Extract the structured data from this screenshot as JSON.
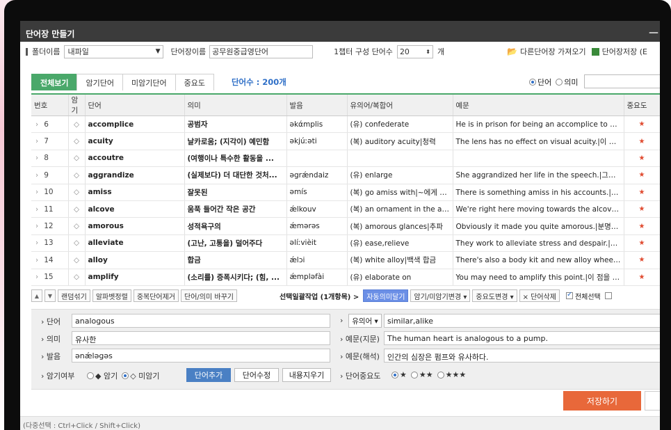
{
  "window": {
    "title": "단어장 만들기"
  },
  "toolbar": {
    "folder_label": "폴더이름",
    "folder_value": "내파일",
    "book_label": "단어장이름",
    "book_value": "공무원중급영단어",
    "chapter_label": "1챕터 구성 단어수",
    "chapter_value": "20",
    "chapter_unit": "개",
    "import_label": "다른단어장 가져오기",
    "save_book_label": "단어장저장 (E"
  },
  "tabs": [
    {
      "label": "전체보기",
      "active": true
    },
    {
      "label": "암기단어"
    },
    {
      "label": "미암기단어"
    },
    {
      "label": "중요도"
    }
  ],
  "word_count": "단어수 : 200개",
  "search_mode": {
    "option1": "단어",
    "option2": "의미",
    "selected": "단어"
  },
  "table": {
    "headers": [
      "번호",
      "암기",
      "단어",
      "의미",
      "발음",
      "유의어/복합어",
      "예문",
      "중요도"
    ],
    "rows": [
      {
        "no": "6",
        "word": "accomplice",
        "meaning": "공범자",
        "pron": "əkάmplis",
        "syn": "(유) confederate",
        "example": "He is in prison for being an accomplice to murd..."
      },
      {
        "no": "7",
        "word": "acuity",
        "meaning": "날카로움; (지각이) 예민함",
        "pron": "əkjúːəti",
        "syn": "(복) auditory acuity|청력",
        "example": "The lens has no effect on visual acuity.|이 렌즈..."
      },
      {
        "no": "8",
        "word": "accoutre",
        "meaning": "(여행이나 특수한 활동을 ...",
        "pron": "",
        "syn": "",
        "example": ""
      },
      {
        "no": "9",
        "word": "aggrandize",
        "meaning": "(실제보다) 더 대단한 것처...",
        "pron": "əgrǽndaiz",
        "syn": "(유) enlarge",
        "example": "She aggrandized her life in the speech.|그녀는 ..."
      },
      {
        "no": "10",
        "word": "amiss",
        "meaning": "잘못된",
        "pron": "əmís",
        "syn": "(복) go amiss with|~에게 잘...",
        "example": "There is something amiss in his accounts.|그의 ..."
      },
      {
        "no": "11",
        "word": "alcove",
        "meaning": "움푹 들어간 작은 공간",
        "pron": "ǽlkouv",
        "syn": "(복) an ornament in the alco...",
        "example": "We're right here moving towards the alcove.|우..."
      },
      {
        "no": "12",
        "word": "amorous",
        "meaning": "성적욕구의",
        "pron": "ǽmərəs",
        "syn": "(복) amorous glances|추파",
        "example": "Obviously it made you quite amorous.|분명히 이..."
      },
      {
        "no": "13",
        "word": "alleviate",
        "meaning": "(고난, 고통을) 덜어주다",
        "pron": "əlíːvièit",
        "syn": "(유) ease,relieve",
        "example": "They work to alleviate stress and despair.|그들은 ..."
      },
      {
        "no": "14",
        "word": "alloy",
        "meaning": "합금",
        "pron": "ǽlɔi",
        "syn": "(복) white alloy|백색 합금",
        "example": "There's also a body kit and new alloy wheels.|저..."
      },
      {
        "no": "15",
        "word": "amplify",
        "meaning": "(소리를) 증폭시키다; (힘, ...",
        "pron": "ǽmpləfài",
        "syn": "(유) elaborate on",
        "example": "You may need to amplify this point.|이 점을 더 ..."
      }
    ],
    "memo_symbol": "◇",
    "star_symbol": "★",
    "row_arrow": "›"
  },
  "tools": {
    "up": "▲",
    "down": "▼",
    "shuffle": "랜덤섞기",
    "alpha": "알파벳정렬",
    "dedup": "중복단어제거",
    "swap": "단어/의미 바꾸기",
    "batch_label": "선택일괄작업 (1개항목) >",
    "auto_meaning": "자동의미달기",
    "memo_change": "암기/미암기변경 ▾",
    "importance_change": "중요도변경 ▾",
    "delete": "× 단어삭제",
    "select_all": "전체선택"
  },
  "form": {
    "word_label": "단어",
    "word_value": "analogous",
    "meaning_label": "의미",
    "meaning_value": "유사한",
    "pron_label": "발음",
    "pron_value": "ənǽləgəs",
    "memo_label": "암기여부",
    "memo_opt1": "◆ 암기",
    "memo_opt2": "◇ 미암기",
    "add_btn": "단어추가",
    "edit_btn": "단어수정",
    "clear_btn": "내용지우기",
    "syn_select": "유의어 ▾",
    "syn_value": "similar,alike",
    "ex_src_label": "예문(지문)",
    "ex_src_value": "The human heart is analogous to a pump.",
    "ex_tr_label": "예문(해석)",
    "ex_tr_value": "인간의 심장은 펌프와 유사하다.",
    "importance_label": "단어중요도",
    "imp_opt1": "★",
    "imp_opt2": "★★",
    "imp_opt3": "★★★"
  },
  "save_label": "저장하기",
  "status_text": "(다중선택 : Ctrl+Click / Shift+Click)",
  "colors": {
    "accent_green": "#4aa86a",
    "save_orange": "#e8683a",
    "blue_button": "#4a80c4",
    "star_red": "#e04a2f"
  }
}
